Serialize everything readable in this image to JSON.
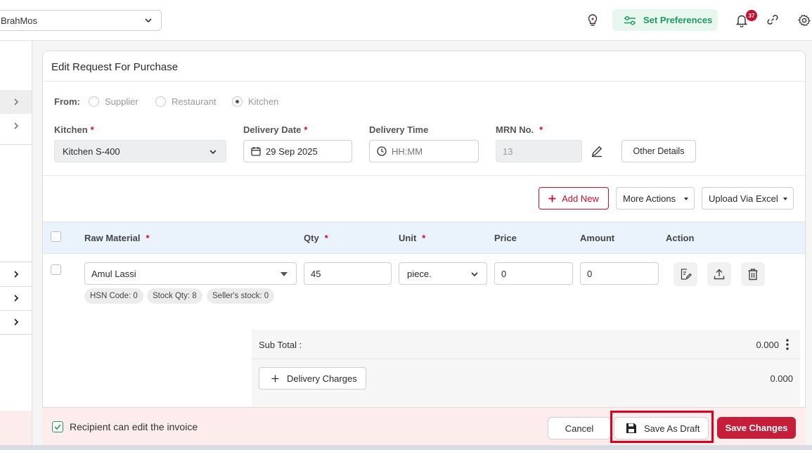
{
  "header": {
    "outlet_name": "BrahMos",
    "preferences_label": "Set Preferences",
    "notification_count": "37"
  },
  "card": {
    "title": "Edit Request For Purchase"
  },
  "from": {
    "label": "From:",
    "options": [
      "Supplier",
      "Restaurant",
      "Kitchen"
    ],
    "selected": "Kitchen"
  },
  "fields": {
    "kitchen_label": "Kitchen",
    "kitchen_value": "Kitchen S-400",
    "delivery_date_label": "Delivery Date",
    "delivery_date_value": "29 Sep 2025",
    "delivery_time_label": "Delivery Time",
    "delivery_time_placeholder": "HH:MM",
    "mrn_label": "MRN No.",
    "mrn_value": "13",
    "other_details_label": "Other Details",
    "required_mark": "*"
  },
  "actions": {
    "add_new": "Add New",
    "more_actions": "More Actions",
    "upload_excel": "Upload Via Excel"
  },
  "table": {
    "headers": [
      "Raw Material",
      "Qty",
      "Unit",
      "Price",
      "Amount",
      "Action"
    ],
    "rows": [
      {
        "raw_material": "Amul Lassi",
        "qty": "45",
        "unit": "piece.",
        "price": "0",
        "amount": "0",
        "chips": [
          "HSN Code: 0",
          "Stock Qty: 8",
          "Seller's stock: 0"
        ]
      }
    ]
  },
  "totals": {
    "sub_total_label": "Sub Total :",
    "sub_total_value": "0.000",
    "delivery_charges_label": "Delivery Charges",
    "delivery_charges_value": "0.000"
  },
  "footer": {
    "recipient_edit_label": "Recipient can edit the invoice",
    "recipient_edit_checked": true,
    "cancel_label": "Cancel",
    "save_draft_label": "Save As Draft",
    "save_changes_label": "Save Changes"
  },
  "colors": {
    "brand_red": "#c41e3a",
    "accent_green": "#1e9a5f",
    "header_row_bg": "#eaf2fc",
    "footer_bg": "#fdecec"
  }
}
